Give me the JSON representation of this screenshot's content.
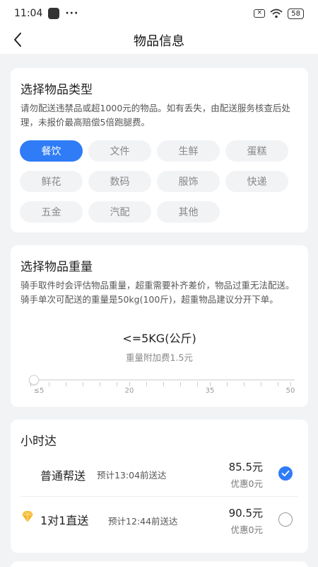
{
  "status": {
    "time": "11:04",
    "dots": "···",
    "battery": "58"
  },
  "nav": {
    "title": "物品信息"
  },
  "item_type": {
    "title": "选择物品类型",
    "desc": "请勿配送违禁品或超1000元的物品。如有丢失，由配送服务核查后处理，未报价最高赔偿5倍跑腿费。",
    "options": [
      "餐饮",
      "文件",
      "生鲜",
      "蛋糕",
      "鲜花",
      "数码",
      "服饰",
      "快递",
      "五金",
      "汽配",
      "其他"
    ],
    "selected": "餐饮"
  },
  "weight": {
    "title": "选择物品重量",
    "desc": "骑手取件时会评估物品重量，超重需要补齐差价，物品过重无法配送。骑手单次可配送的重量是50kg(100斤)，超重物品建议分开下单。",
    "value_label": "<=5KG(公斤)",
    "fee": "重量附加费1.5元",
    "slider_value": 5,
    "ticks": [
      "≤5",
      "20",
      "35",
      "50"
    ]
  },
  "service": {
    "title": "小时达",
    "options": [
      {
        "name": "普通帮送",
        "eta": "预计13:04前送达",
        "price": "85.5元",
        "discount": "优惠0元",
        "selected": true
      },
      {
        "name": "1对1直送",
        "eta": "预计12:44前送达",
        "price": "90.5元",
        "discount": "优惠0元",
        "selected": false
      }
    ]
  },
  "colors": {
    "accent": "#2f7cf6",
    "diamond": "#f5b82e"
  }
}
